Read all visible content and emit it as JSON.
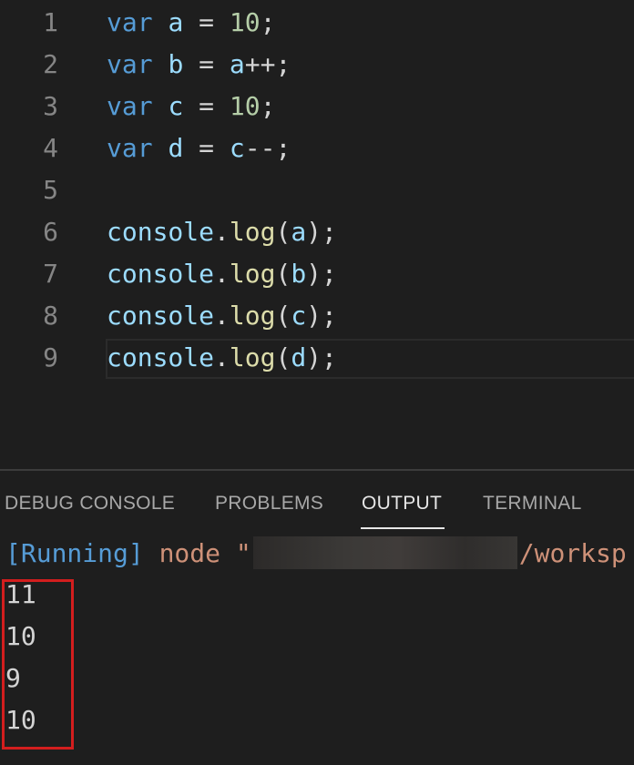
{
  "editor": {
    "lines": [
      {
        "num": "1",
        "kw": "var",
        "name": "a",
        "eq": " = ",
        "rhs": "10",
        "end": ";"
      },
      {
        "num": "2",
        "kw": "var",
        "name": "b",
        "eq": " = ",
        "rhs": "a",
        "rhs_op": "++",
        "end": ";"
      },
      {
        "num": "3",
        "kw": "var",
        "name": "c",
        "eq": " = ",
        "rhs": "10",
        "end": ";"
      },
      {
        "num": "4",
        "kw": "var",
        "name": "d",
        "eq": " = ",
        "rhs": "c",
        "rhs_op": "--",
        "end": ";"
      },
      {
        "num": "5"
      },
      {
        "num": "6",
        "obj": "console",
        "dot": ".",
        "fn": "log",
        "open": "(",
        "arg": "a",
        "close": ");"
      },
      {
        "num": "7",
        "obj": "console",
        "dot": ".",
        "fn": "log",
        "open": "(",
        "arg": "b",
        "close": ");"
      },
      {
        "num": "8",
        "obj": "console",
        "dot": ".",
        "fn": "log",
        "open": "(",
        "arg": "c",
        "close": ");"
      },
      {
        "num": "9",
        "obj": "console",
        "dot": ".",
        "fn": "log",
        "open": "(",
        "arg": "d",
        "close": ");"
      }
    ]
  },
  "panel": {
    "tabs": [
      {
        "label": "DEBUG CONSOLE"
      },
      {
        "label": "PROBLEMS"
      },
      {
        "label": "OUTPUT",
        "active": true
      },
      {
        "label": "TERMINAL"
      }
    ],
    "output": {
      "running_tag": "[Running]",
      "command_prefix": " node \"",
      "command_suffix": "/worksp",
      "results": [
        "11",
        "10",
        "9",
        "10"
      ]
    }
  },
  "colors": {
    "background": "#1e1e1e",
    "keyword": "#569cd6",
    "variable": "#9cdcfe",
    "number": "#b5cea8",
    "function": "#dcdcaa",
    "string": "#ce9178",
    "highlight_box": "#d31e1e"
  }
}
